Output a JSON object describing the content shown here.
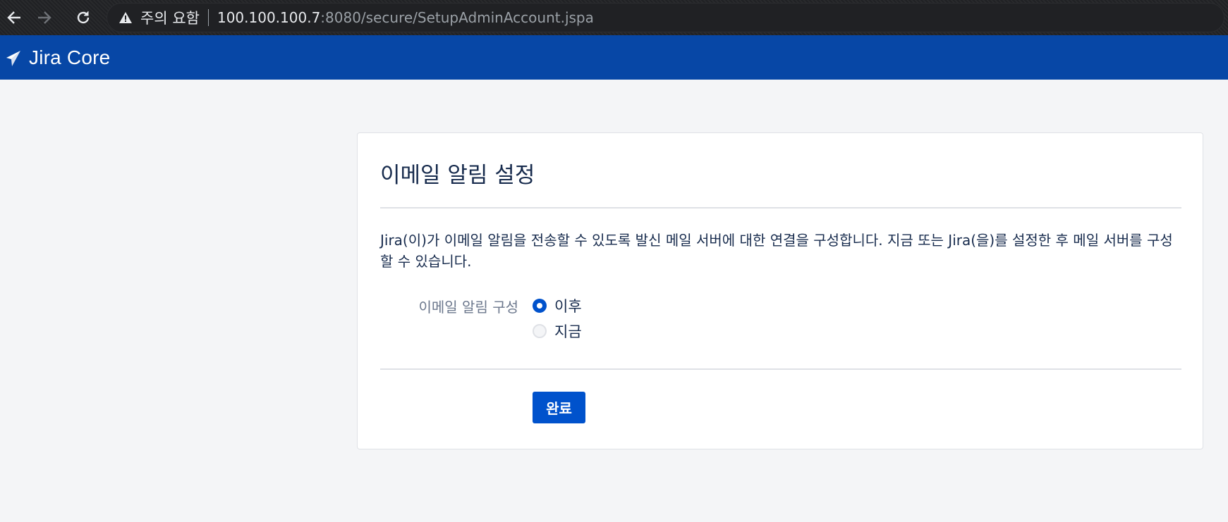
{
  "browser": {
    "back_icon": "arrow-left-icon",
    "forward_icon": "arrow-right-icon",
    "reload_icon": "reload-icon",
    "security_warning": "주의 요함",
    "url_host": "100.100.100.7",
    "url_rest": ":8080/secure/SetupAdminAccount.jspa"
  },
  "header": {
    "product_name": "Jira Core",
    "bg_color": "#0747a6"
  },
  "setup": {
    "title": "이메일 알림 설정",
    "description": "Jira(이)가 이메일 알림을 전송할 수 있도록 발신 메일 서버에 대한 연결을 구성합니다. 지금 또는 Jira(을)를 설정한 후 메일 서버를 구성할 수 있습니다.",
    "field_label": "이메일 알림 구성",
    "options": [
      {
        "label": "이후",
        "checked": true
      },
      {
        "label": "지금",
        "checked": false
      }
    ],
    "submit_label": "완료",
    "accent_color": "#0052cc"
  }
}
